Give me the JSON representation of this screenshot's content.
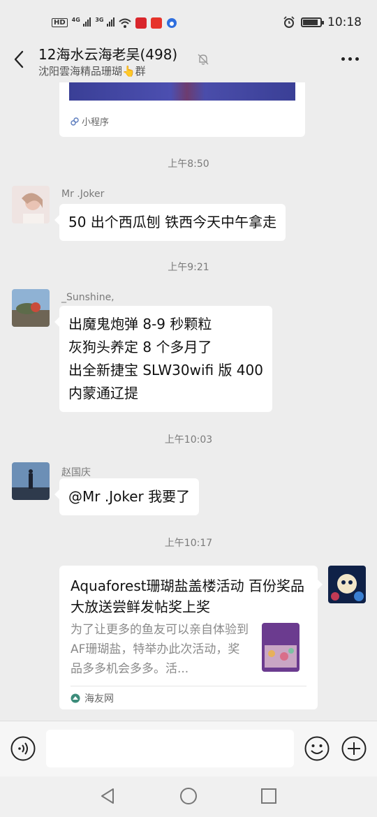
{
  "status_bar": {
    "hd_label": "HD",
    "net1_label": "4G",
    "net2_label": "3G",
    "time": "10:18",
    "battery_level": 0.9
  },
  "header": {
    "title": "12海水云海老吴(498)",
    "subtitle": "沈阳雲海精品珊瑚👆群"
  },
  "messages": {
    "top_card": {
      "source_label": "小程序"
    },
    "time1": "上午8:50",
    "msg1": {
      "sender": "Mr .Joker",
      "lines": [
        "50 出个西瓜刨 铁西今天中午拿走"
      ]
    },
    "time2": "上午9:21",
    "msg2": {
      "sender": "_Sunshine,",
      "lines": [
        "出魔鬼炮弹 8-9 秒颗粒",
        "灰狗头养定 8 个多月了",
        "出全新捷宝 SLW30wifi 版 400",
        "内蒙通辽提"
      ]
    },
    "time3": "上午10:03",
    "msg3": {
      "sender": "赵国庆",
      "lines": [
        "@Mr .Joker  我要了"
      ]
    },
    "time4": "上午10:17",
    "link": {
      "title": "Aquaforest珊瑚盐盖楼活动 百份奖品大放送尝鲜发帖奖上奖",
      "desc": "为了让更多的鱼友可以亲自体验到AF珊瑚盐，特举办此次活动，奖品多多机会多多。活...",
      "source": "海友网"
    }
  },
  "input": {
    "placeholder": ""
  },
  "colors": {
    "background": "#ededed",
    "bubble": "#ffffff",
    "time_text": "#7a7a7a"
  }
}
